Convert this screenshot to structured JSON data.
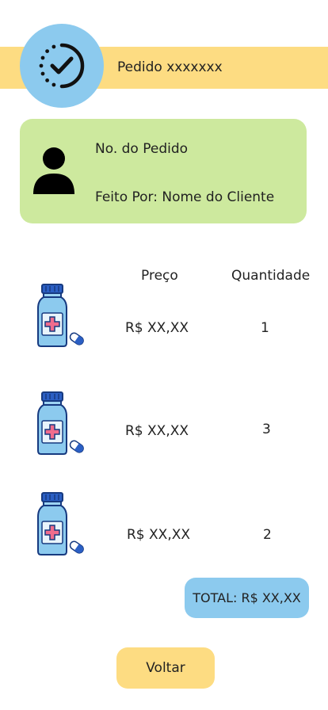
{
  "header": {
    "title": "Pedido xxxxxxx",
    "icon": "check-circle-icon"
  },
  "customer_card": {
    "icon": "user-icon",
    "order_number_label": "No. do Pedido",
    "made_by_label": "Feito Por: Nome do Cliente"
  },
  "items_table": {
    "price_header": "Preço",
    "quantity_header": "Quantidade",
    "rows": [
      {
        "icon": "medicine-bottle-icon",
        "price": "R$ XX,XX",
        "quantity": "1"
      },
      {
        "icon": "medicine-bottle-icon",
        "price": "R$ XX,XX",
        "quantity": "3"
      },
      {
        "icon": "medicine-bottle-icon",
        "price": "R$ XX,XX",
        "quantity": "2"
      }
    ]
  },
  "total": {
    "label": "TOTAL: R$ XX,XX"
  },
  "actions": {
    "back_label": "Voltar"
  },
  "colors": {
    "header_yellow": "#fddc82",
    "light_blue": "#8ccaee",
    "card_green": "#cde99e"
  }
}
